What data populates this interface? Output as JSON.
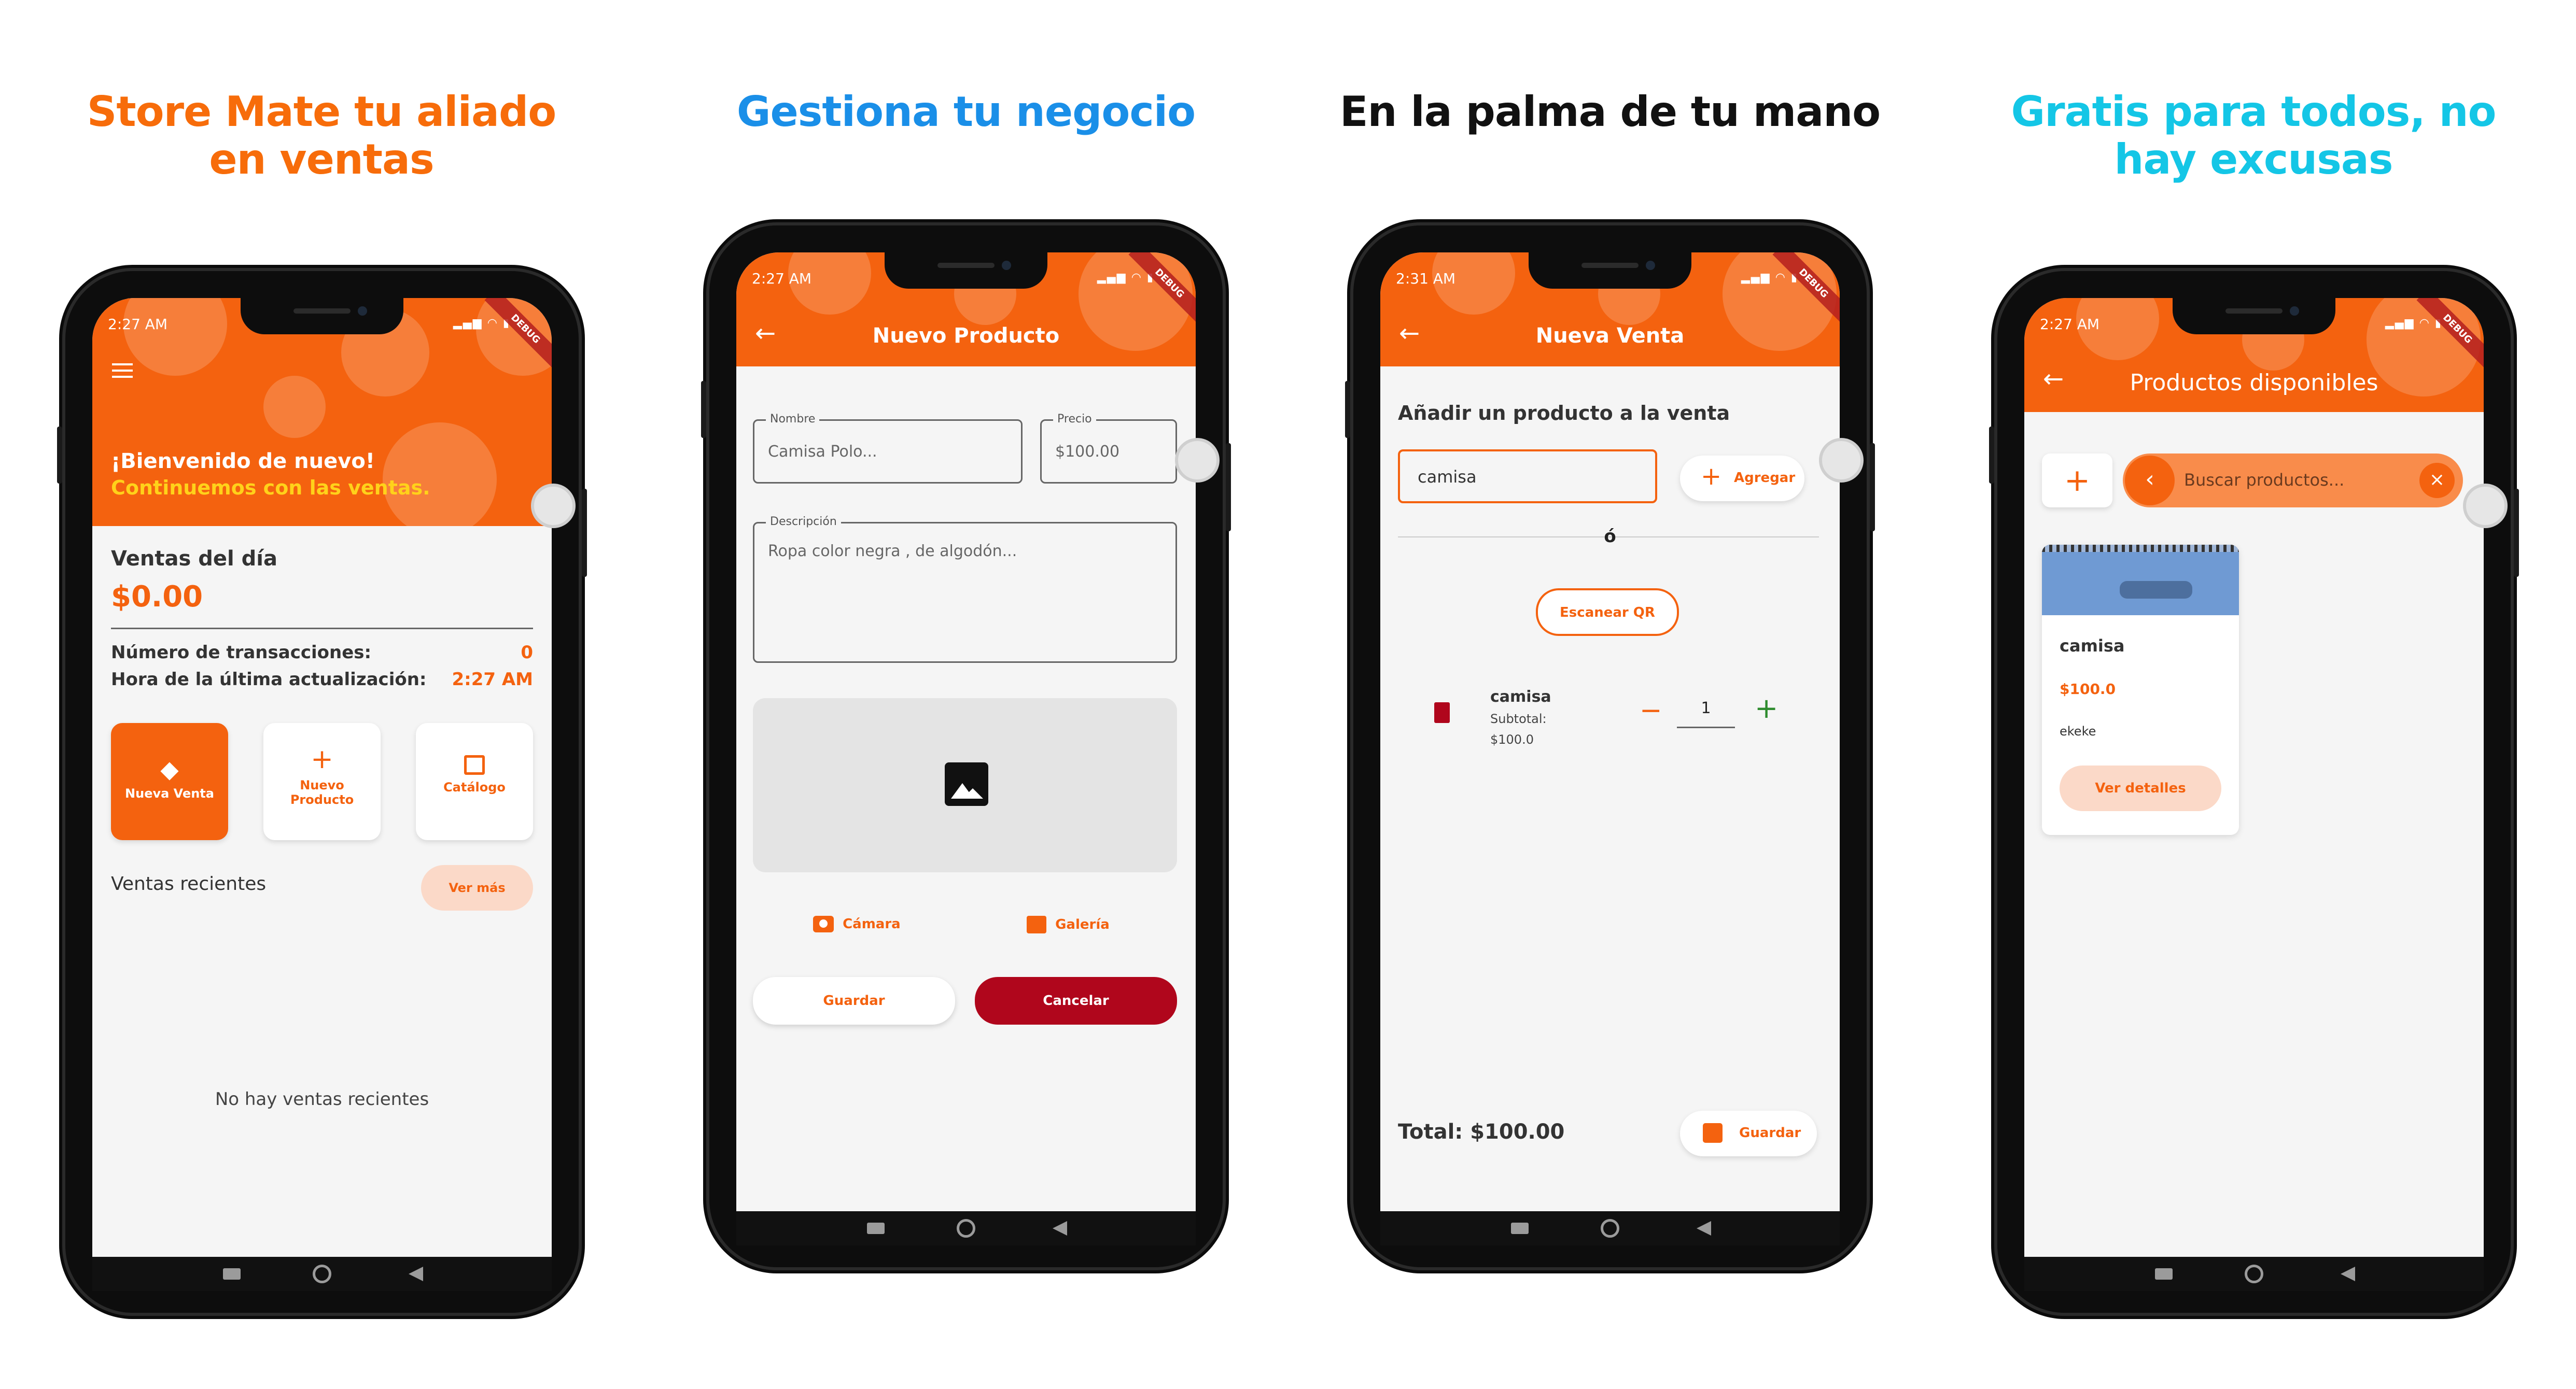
{
  "headings": [
    {
      "text": "Store Mate tu aliado en ventas",
      "color": "#f76c0a"
    },
    {
      "text": "Gestiona tu negocio",
      "color": "#1a8fe8"
    },
    {
      "text": "En la palma de tu mano",
      "color": "#111111"
    },
    {
      "text": "Gratis para todos, no hay excusas",
      "color": "#14c6e6"
    }
  ],
  "status": {
    "time1": "2:27 AM",
    "time3": "2:31 AM",
    "debug": "DEBUG"
  },
  "home": {
    "welcome": "¡Bienvenido de nuevo!",
    "subtitle": "Continuemos con las ventas.",
    "sales_title": "Ventas del día",
    "sales_amount": "$0.00",
    "tx_label": "Número de transacciones:",
    "tx_value": "0",
    "updated_label": "Hora de la última actualización:",
    "updated_value": "2:27 AM",
    "actions": [
      "Nueva Venta",
      "Nuevo Producto",
      "Catálogo"
    ],
    "recent_title": "Ventas recientes",
    "see_more": "Ver más",
    "empty": "No hay ventas recientes"
  },
  "new_product": {
    "title": "Nuevo Producto",
    "name_label": "Nombre",
    "name_value": "Camisa Polo...",
    "price_label": "Precio",
    "price_value": "$100.00",
    "desc_label": "Descripción",
    "desc_value": "Ropa color negra , de algodón...",
    "camera": "Cámara",
    "gallery": "Galería",
    "save": "Guardar",
    "cancel": "Cancelar"
  },
  "new_sale": {
    "title": "Nueva Venta",
    "add_title": "Añadir un producto a la venta",
    "search_value": "camisa",
    "add": "Agregar",
    "or": "ó",
    "scan": "Escanear QR",
    "item_name": "camisa",
    "subtotal_label": "Subtotal:",
    "subtotal_value": "$100.0",
    "qty": "1",
    "total": "Total: $100.00",
    "save": "Guardar"
  },
  "products": {
    "title": "Productos disponibles",
    "search_placeholder": "Buscar productos...",
    "card_name": "camisa",
    "card_price": "$100.0",
    "card_desc": "ekeke",
    "card_button": "Ver detalles"
  },
  "colors": {
    "accent": "#f4620f",
    "danger": "#b0061c",
    "green": "#2e8b2e"
  }
}
